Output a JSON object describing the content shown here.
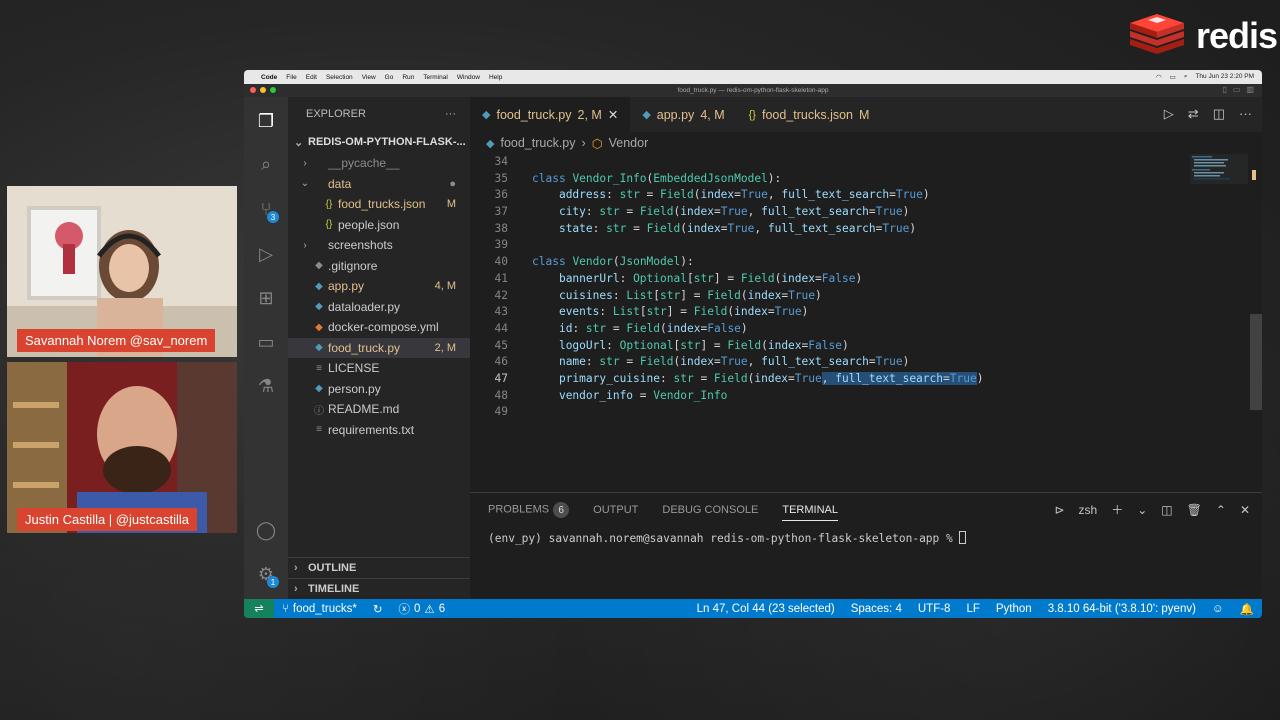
{
  "brand": {
    "name": "redis"
  },
  "speakers": [
    {
      "label": "Savannah Norem @sav_norem"
    },
    {
      "label": "Justin Castilla | @justcastilla"
    }
  ],
  "mac_menubar": {
    "apple": "",
    "app": "Code",
    "menus": [
      "File",
      "Edit",
      "Selection",
      "View",
      "Go",
      "Run",
      "Terminal",
      "Window",
      "Help"
    ],
    "clock": "Thu Jun 23  2:20 PM"
  },
  "window_title": "food_truck.py — redis-om-python-flask-skeleton-app",
  "activity_bar": {
    "scm_badge": "3",
    "settings_badge": "1"
  },
  "explorer": {
    "header": "EXPLORER",
    "more": "···",
    "root": "REDIS-OM-PYTHON-FLASK-...",
    "items": [
      {
        "name": "__pycache__",
        "chev": "›",
        "icon": "",
        "status": "",
        "indent": 1,
        "color": "#8c8c8c"
      },
      {
        "name": "data",
        "chev": "⌄",
        "icon": "",
        "status": "●",
        "indent": 1,
        "color": "#e2c08d"
      },
      {
        "name": "food_trucks.json",
        "chev": "",
        "icon": "{}",
        "status": "M",
        "indent": 2,
        "color": "#e2c08d"
      },
      {
        "name": "people.json",
        "chev": "",
        "icon": "{}",
        "status": "",
        "indent": 2,
        "color": "#cccccc"
      },
      {
        "name": "screenshots",
        "chev": "›",
        "icon": "",
        "status": "",
        "indent": 1,
        "color": "#cccccc"
      },
      {
        "name": ".gitignore",
        "chev": "",
        "icon": "◆",
        "status": "",
        "indent": 1,
        "color": "#cccccc"
      },
      {
        "name": "app.py",
        "chev": "",
        "icon": "◆",
        "status": "4, M",
        "indent": 1,
        "color": "#e2c08d"
      },
      {
        "name": "dataloader.py",
        "chev": "",
        "icon": "◆",
        "status": "",
        "indent": 1,
        "color": "#cccccc"
      },
      {
        "name": "docker-compose.yml",
        "chev": "",
        "icon": "◆",
        "status": "",
        "indent": 1,
        "color": "#cccccc"
      },
      {
        "name": "food_truck.py",
        "chev": "",
        "icon": "◆",
        "status": "2, M",
        "indent": 1,
        "color": "#e2c08d"
      },
      {
        "name": "LICENSE",
        "chev": "",
        "icon": "≡",
        "status": "",
        "indent": 1,
        "color": "#cccccc"
      },
      {
        "name": "person.py",
        "chev": "",
        "icon": "◆",
        "status": "",
        "indent": 1,
        "color": "#cccccc"
      },
      {
        "name": "README.md",
        "chev": "",
        "icon": "ⓘ",
        "status": "",
        "indent": 1,
        "color": "#cccccc"
      },
      {
        "name": "requirements.txt",
        "chev": "",
        "icon": "≡",
        "status": "",
        "indent": 1,
        "color": "#cccccc"
      }
    ],
    "outline": "OUTLINE",
    "timeline": "TIMELINE"
  },
  "tabs": [
    {
      "name": "food_truck.py",
      "status": "2, M",
      "active": true,
      "close": "✕"
    },
    {
      "name": "app.py",
      "status": "4, M",
      "active": false,
      "close": ""
    },
    {
      "name": "food_trucks.json",
      "status": "M",
      "active": false,
      "close": ""
    }
  ],
  "breadcrumb": {
    "file": "food_truck.py",
    "sep": "›",
    "symbol": "Vendor"
  },
  "code_lines": [
    {
      "n": "34",
      "html": ""
    },
    {
      "n": "35",
      "html": "<span class='k'>class</span> <span class='c'>Vendor_Info</span>(<span class='c'>EmbeddedJsonModel</span>):"
    },
    {
      "n": "36",
      "html": "    <span class='v'>address</span>: <span class='c'>str</span> = <span class='c'>Field</span>(<span class='v'>index</span>=<span class='b'>True</span>, <span class='v'>full_text_search</span>=<span class='b'>True</span>)"
    },
    {
      "n": "37",
      "html": "    <span class='v'>city</span>: <span class='c'>str</span> = <span class='c'>Field</span>(<span class='v'>index</span>=<span class='b'>True</span>, <span class='v'>full_text_search</span>=<span class='b'>True</span>)"
    },
    {
      "n": "38",
      "html": "    <span class='v'>state</span>: <span class='c'>str</span> = <span class='c'>Field</span>(<span class='v'>index</span>=<span class='b'>True</span>, <span class='v'>full_text_search</span>=<span class='b'>True</span>)"
    },
    {
      "n": "39",
      "html": ""
    },
    {
      "n": "40",
      "html": "<span class='k'>class</span> <span class='c'>Vendor</span>(<span class='c'>JsonModel</span>):"
    },
    {
      "n": "41",
      "html": "    <span class='v'>bannerUrl</span>: <span class='c'>Optional</span>[<span class='c'>str</span>] = <span class='c'>Field</span>(<span class='v'>index</span>=<span class='b'>False</span>)"
    },
    {
      "n": "42",
      "html": "    <span class='v'>cuisines</span>: <span class='c'>List</span>[<span class='c'>str</span>] = <span class='c'>Field</span>(<span class='v'>index</span>=<span class='b'>True</span>)"
    },
    {
      "n": "43",
      "html": "    <span class='v'>events</span>: <span class='c'>List</span>[<span class='c'>str</span>] = <span class='c'>Field</span>(<span class='v'>index</span>=<span class='b'>True</span>)"
    },
    {
      "n": "44",
      "html": "    <span class='v'>id</span>: <span class='c'>str</span> = <span class='c'>Field</span>(<span class='v'>index</span>=<span class='b'>False</span>)"
    },
    {
      "n": "45",
      "html": "    <span class='v'>logoUrl</span>: <span class='c'>Optional</span>[<span class='c'>str</span>] = <span class='c'>Field</span>(<span class='v'>index</span>=<span class='b'>False</span>)"
    },
    {
      "n": "46",
      "html": "    <span class='v'>name</span>: <span class='c'>str</span> = <span class='c'>Field</span>(<span class='v'>index</span>=<span class='b'>True</span>, <span class='v'>full_text_search</span>=<span class='b'>True</span>)"
    },
    {
      "n": "47",
      "html": "    <span class='v'>primary_cuisine</span>: <span class='c'>str</span> = <span class='c'>Field</span>(<span class='v'>index</span>=<span class='b'>True</span><span class='sel'>, <span class='v'>full_text_search</span>=<span class='b'>True</span></span>)"
    },
    {
      "n": "48",
      "html": "    <span class='v'>vendor_info</span> = <span class='c'>Vendor_Info</span>"
    },
    {
      "n": "49",
      "html": ""
    }
  ],
  "current_line": "47",
  "panel": {
    "tabs": [
      "PROBLEMS",
      "OUTPUT",
      "DEBUG CONSOLE",
      "TERMINAL"
    ],
    "problems_count": "6",
    "active_tab": "TERMINAL",
    "shell": "zsh",
    "prompt": "(env_py) savannah.norem@savannah redis-om-python-flask-skeleton-app % "
  },
  "statusbar": {
    "remote": "⇌",
    "branch": "food_trucks*",
    "sync": "↻",
    "errors": "0",
    "warnings": "6",
    "cursor": "Ln 47, Col 44 (23 selected)",
    "spaces": "Spaces: 4",
    "encoding": "UTF-8",
    "eol": "LF",
    "language": "Python",
    "interpreter": "3.8.10 64-bit ('3.8.10': pyenv)"
  },
  "colors": {
    "accent": "#007acc",
    "modified": "#e2c08d",
    "nameplate": "#d8442f",
    "redis_red": "#dc382c"
  }
}
